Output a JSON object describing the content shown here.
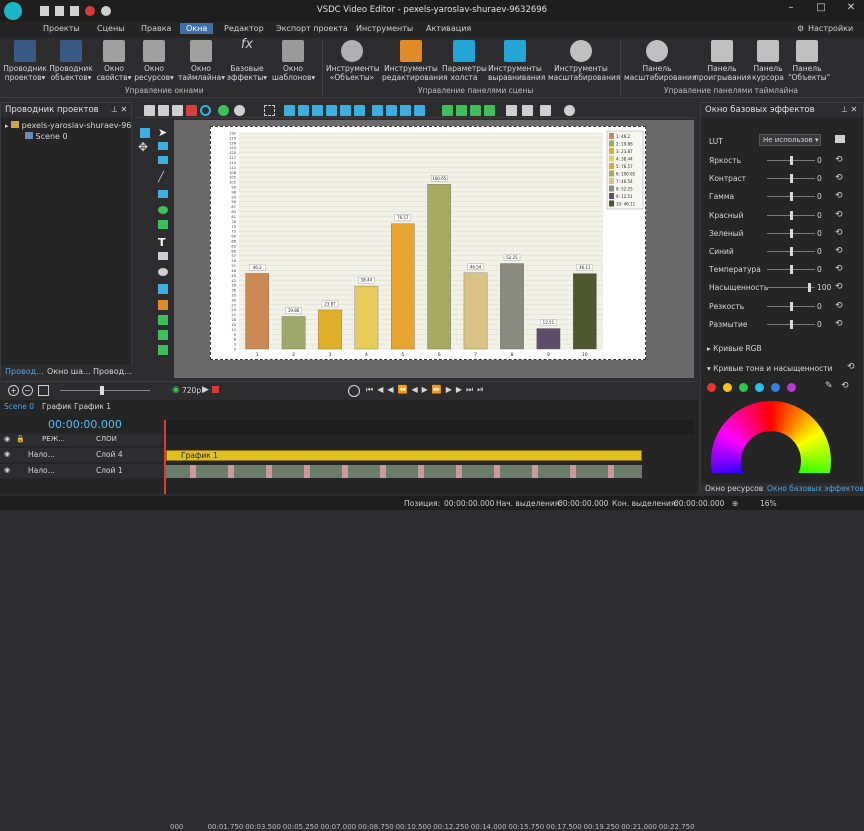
{
  "window": {
    "title": "VSDC Video Editor - pexels-yaroslav-shuraev-9632696",
    "settings_label": "Настройки"
  },
  "menu": {
    "items": [
      "Проекты",
      "Сцены",
      "Правка",
      "Окна",
      "Редактор",
      "Экспорт проекта",
      "Инструменты",
      "Активация"
    ],
    "active": "Окна"
  },
  "ribbon": {
    "buttons": [
      {
        "label": "Проводник проектов▾"
      },
      {
        "label": "Проводник объектов▾"
      },
      {
        "label": "Окно свойств▾"
      },
      {
        "label": "Окно ресурсов▾"
      },
      {
        "label": "Окно таймлайна▾"
      },
      {
        "label": "Базовые эффекты▾"
      },
      {
        "label": "Окно шаблонов▾"
      },
      {
        "label": "Инструменты «Объекты»"
      },
      {
        "label": "Инструменты редактирования"
      },
      {
        "label": "Параметры холста"
      },
      {
        "label": "Инструменты выравнивания"
      },
      {
        "label": "Инструменты масштабирования"
      },
      {
        "label": "Панель масштабирования"
      },
      {
        "label": "Панель проигрывания"
      },
      {
        "label": "Панель курсора"
      },
      {
        "label": "Панель \"Объекты\""
      }
    ],
    "groups": [
      "Управление окнами",
      "Управление панелями сцены",
      "Управление панелями таймлайна"
    ]
  },
  "project_explorer": {
    "title": "Проводник проектов",
    "tree": [
      "pexels-yaroslav-shuraev-96",
      "Scene 0"
    ],
    "tabs": [
      "Провод...",
      "Окно ша...",
      "Провод..."
    ]
  },
  "effects": {
    "title": "Окно базовых эффектов",
    "lut_label": "LUT",
    "lut_value": "Не использов",
    "sliders": [
      {
        "label": "Яркость",
        "value": "0",
        "level": 0.5
      },
      {
        "label": "Контраст",
        "value": "0",
        "level": 0.5
      },
      {
        "label": "Гамма",
        "value": "0",
        "level": 0.5
      },
      {
        "label": "Красный",
        "value": "0",
        "level": 0.5
      },
      {
        "label": "Зеленый",
        "value": "0",
        "level": 0.5
      },
      {
        "label": "Синий",
        "value": "0",
        "level": 0.5
      },
      {
        "label": "Температура",
        "value": "0",
        "level": 0.5
      },
      {
        "label": "Насыщенность",
        "value": "100",
        "level": 0.9
      },
      {
        "label": "Резкость",
        "value": "0",
        "level": 0.5
      },
      {
        "label": "Размытие",
        "value": "0",
        "level": 0.5
      }
    ],
    "curves_rgb": "Кривые RGB",
    "curves_hue": "Кривые тона и насыщенности",
    "swatch_colors": [
      "#e8342c",
      "#f5c21b",
      "#2ec74b",
      "#1fc3e8",
      "#3b7de0",
      "#b43bd1"
    ],
    "tabs": [
      "Окно ресурсов",
      "Окно базовых эффектов"
    ]
  },
  "preview_toolbar": {
    "resolution": "720p"
  },
  "timeline": {
    "scene_tab": "Scene 0",
    "chart_tab": "График График 1",
    "timecode": "00:00:00.000",
    "ruler": [
      "000",
      "00:01.750",
      "00:03.500",
      "00:05.250",
      "00:07.000",
      "00:08.750",
      "00:10.500",
      "00:12.250",
      "00:14.000",
      "00:15.750",
      "00:17.500",
      "00:19.250",
      "00:21.000",
      "00:22.750"
    ],
    "header_cols": {
      "mode": "РЕЖ...",
      "layers": "СЛОИ"
    },
    "tracks": [
      {
        "blend": "Нало...",
        "name": "Слой 4",
        "clip": "График 1"
      },
      {
        "blend": "Нало...",
        "name": "Слой 1",
        "clip": ""
      }
    ]
  },
  "status": {
    "position_label": "Позиция:",
    "position": "00:00:00.000",
    "sel_start_label": "Нач. выделения:",
    "sel_start": "00:00:00.000",
    "sel_end_label": "Кон. выделения:",
    "sel_end": "00:00:00.000",
    "zoom": "16%"
  },
  "chart_data": {
    "type": "bar",
    "categories": [
      "1",
      "2",
      "3",
      "4",
      "5",
      "6",
      "7",
      "8",
      "9",
      "10"
    ],
    "values": [
      46.2,
      19.86,
      23.87,
      38.44,
      76.57,
      100.65,
      46.54,
      52.25,
      12.51,
      46.11
    ],
    "data_labels": [
      "46.2",
      "19.86",
      "23.87",
      "38.44",
      "76.57",
      "100.65",
      "46.54",
      "52.25",
      "12.51",
      "46.11"
    ],
    "colors": [
      "#c98a55",
      "#9ea86a",
      "#e0b02a",
      "#e8cc5a",
      "#e6a430",
      "#a7ab62",
      "#d9c283",
      "#898b80",
      "#5d4d6b",
      "#4d5730"
    ],
    "legend": [
      "1: 46.2",
      "2: 19.86",
      "3: 23.87",
      "4: 38.44",
      "5: 76.57",
      "6: 100.65",
      "7: 46.54",
      "8: 52.25",
      "9: 12.51",
      "10: 46.11"
    ],
    "yticks": [
      "0",
      "3",
      "6",
      "9",
      "12",
      "15",
      "18",
      "21",
      "24",
      "27",
      "30",
      "33",
      "36",
      "39",
      "42",
      "45",
      "48",
      "51",
      "54",
      "57",
      "60",
      "63",
      "66",
      "69",
      "72",
      "75",
      "78",
      "81",
      "84",
      "87",
      "90",
      "93",
      "96",
      "99",
      "102",
      "105",
      "108",
      "111",
      "114",
      "117",
      "120",
      "123",
      "126",
      "129",
      "132"
    ],
    "ylim": [
      0,
      132
    ]
  }
}
